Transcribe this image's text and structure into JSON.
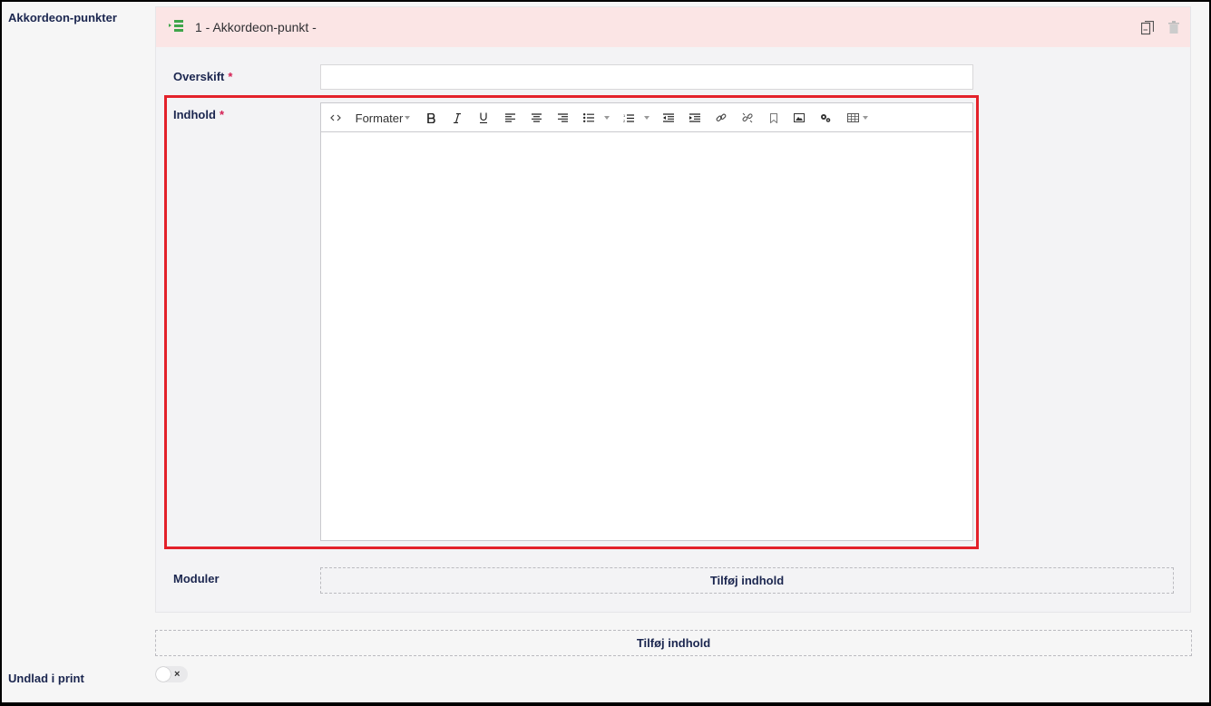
{
  "fields": {
    "accordion_points_label": "Akkordeon-punkter",
    "exclude_print_label": "Undlad i print"
  },
  "panel": {
    "title": "1 - Akkordeon-punkt -",
    "heading_label": "Overskift",
    "content_label": "Indhold",
    "required_mark": "*",
    "heading_value": "",
    "modules_label": "Moduler",
    "add_content_label": "Tilføj indhold"
  },
  "editor": {
    "format_dropdown_label": "Formater",
    "toolbar_icons": [
      "source-code-icon",
      "bold-icon",
      "italic-icon",
      "underline-icon",
      "align-left-icon",
      "align-center-icon",
      "align-right-icon",
      "bullet-list-icon",
      "numbered-list-icon",
      "outdent-icon",
      "indent-icon",
      "link-icon",
      "unlink-icon",
      "anchor-icon",
      "image-icon",
      "macro-icon",
      "table-icon"
    ],
    "content": ""
  },
  "footer": {
    "add_content_label": "Tilføj indhold",
    "toggle_off_symbol": "×"
  },
  "colors": {
    "required": "#d42054",
    "highlight_border": "#e3212a",
    "panel_header_bg": "#fbe5e5",
    "drag_icon": "#3fa54a",
    "text_navy": "#1b264f"
  }
}
